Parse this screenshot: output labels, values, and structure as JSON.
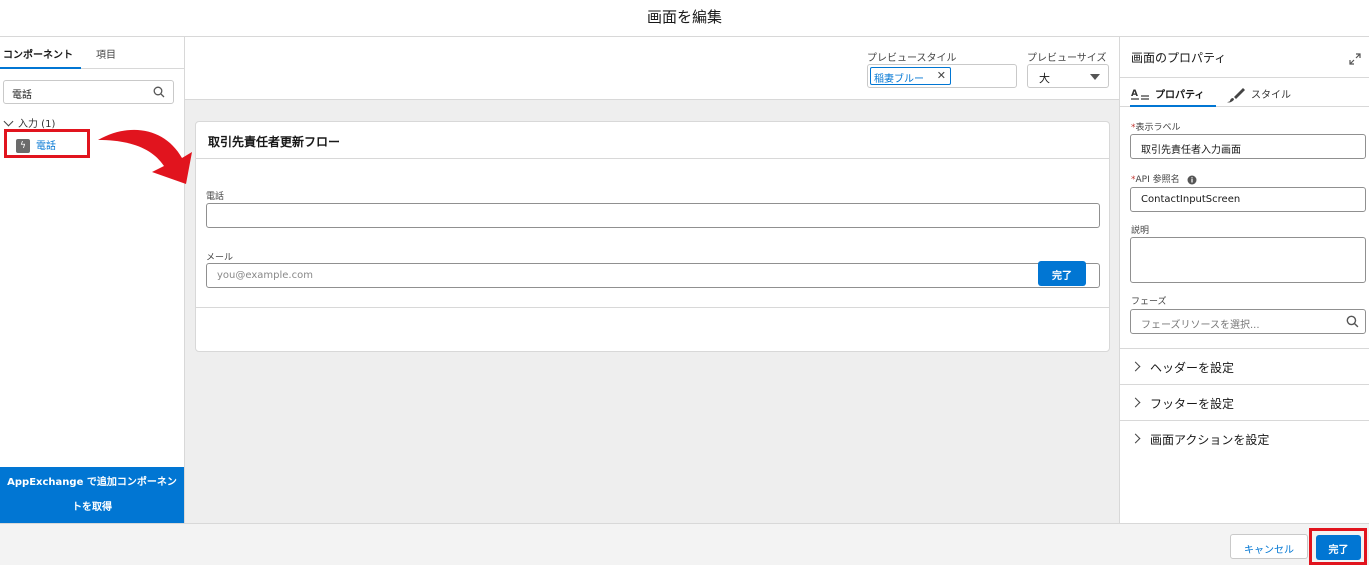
{
  "modal": {
    "title": "画面を編集"
  },
  "left_panel": {
    "tabs": [
      {
        "label": "コンポーネント",
        "active": true
      },
      {
        "label": "項目",
        "active": false
      }
    ],
    "search": {
      "value": "電話"
    },
    "group": {
      "label": "入力 (1)"
    },
    "items": [
      {
        "label": "電話",
        "icon": "lightning-icon"
      }
    ],
    "appexchange": {
      "line1": "AppExchange で追加コンポーネン",
      "line2": "トを取得"
    }
  },
  "preview": {
    "style_label": "プレビュースタイル",
    "style_value": "稲妻ブルー",
    "size_label": "プレビューサイズ",
    "size_value": "大"
  },
  "screen": {
    "title": "取引先責任者更新フロー",
    "fields": [
      {
        "label": "電話",
        "value": "",
        "placeholder": ""
      },
      {
        "label": "メール",
        "value": "",
        "placeholder": "you@example.com"
      }
    ],
    "done_label": "完了"
  },
  "properties": {
    "title": "画面のプロパティ",
    "tabs": [
      {
        "label": "プロパティ",
        "active": true
      },
      {
        "label": "スタイル",
        "active": false
      }
    ],
    "display_label": {
      "label": "表示ラベル",
      "required": true,
      "value": "取引先責任者入力画面"
    },
    "api_name": {
      "label": "API 参照名",
      "required": true,
      "value": "ContactInputScreen"
    },
    "description": {
      "label": "説明",
      "value": ""
    },
    "phase": {
      "label": "フェーズ",
      "placeholder": "フェーズリソースを選択..."
    },
    "sections": [
      "ヘッダーを設定",
      "フッターを設定",
      "画面アクションを設定"
    ]
  },
  "footer": {
    "cancel_label": "キャンセル",
    "finish_label": "完了"
  },
  "colors": {
    "brand": "#0176d3",
    "highlight": "#e1141e"
  }
}
